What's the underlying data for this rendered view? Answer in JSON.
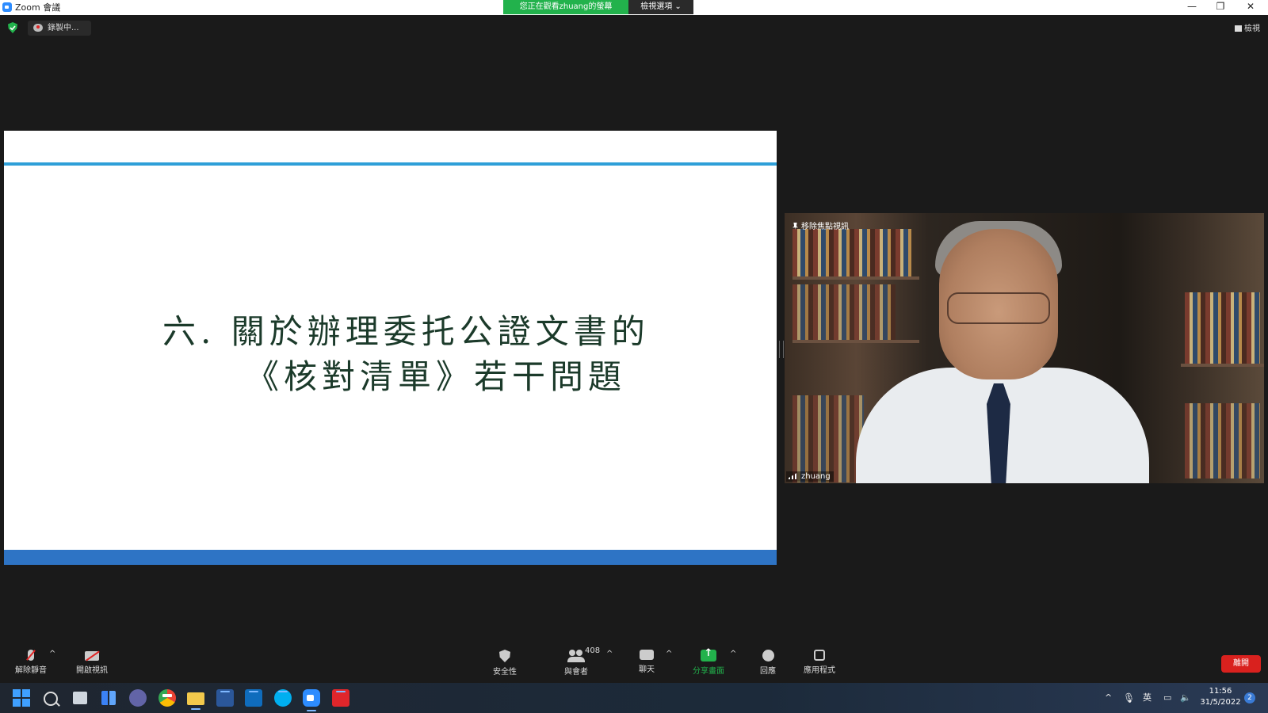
{
  "window": {
    "title": "Zoom 會議",
    "banner": "您正在觀看zhuang的螢幕",
    "view_options": "檢視選項 ⌄",
    "minimize": "—",
    "restore": "❐",
    "close": "✕"
  },
  "status": {
    "recording": "錄製中...",
    "view": "檢視"
  },
  "slide": {
    "line1": "六. 關於辦理委托公證文書的",
    "line2": "《核對清單》若干問題"
  },
  "video": {
    "pin_label": "移除焦點視訊",
    "participant_name": "zhuang"
  },
  "controls": {
    "unmute": "解除靜音",
    "start_video": "開啟視訊",
    "security": "安全性",
    "participants": "與會者",
    "participant_count": "408",
    "chat": "聊天",
    "share_screen": "分享畫面",
    "reactions": "回應",
    "apps": "應用程式",
    "leave": "離開"
  },
  "taskbar": {
    "tray_up": "^",
    "ime": "英",
    "time": "11:56",
    "date": "31/5/2022",
    "notifications": "2"
  },
  "colors": {
    "zoom_green": "#22b24c",
    "leave_red": "#d9211e",
    "slide_top_bar": "#2e9fd8",
    "slide_bottom_bar": "#2e74c5"
  }
}
